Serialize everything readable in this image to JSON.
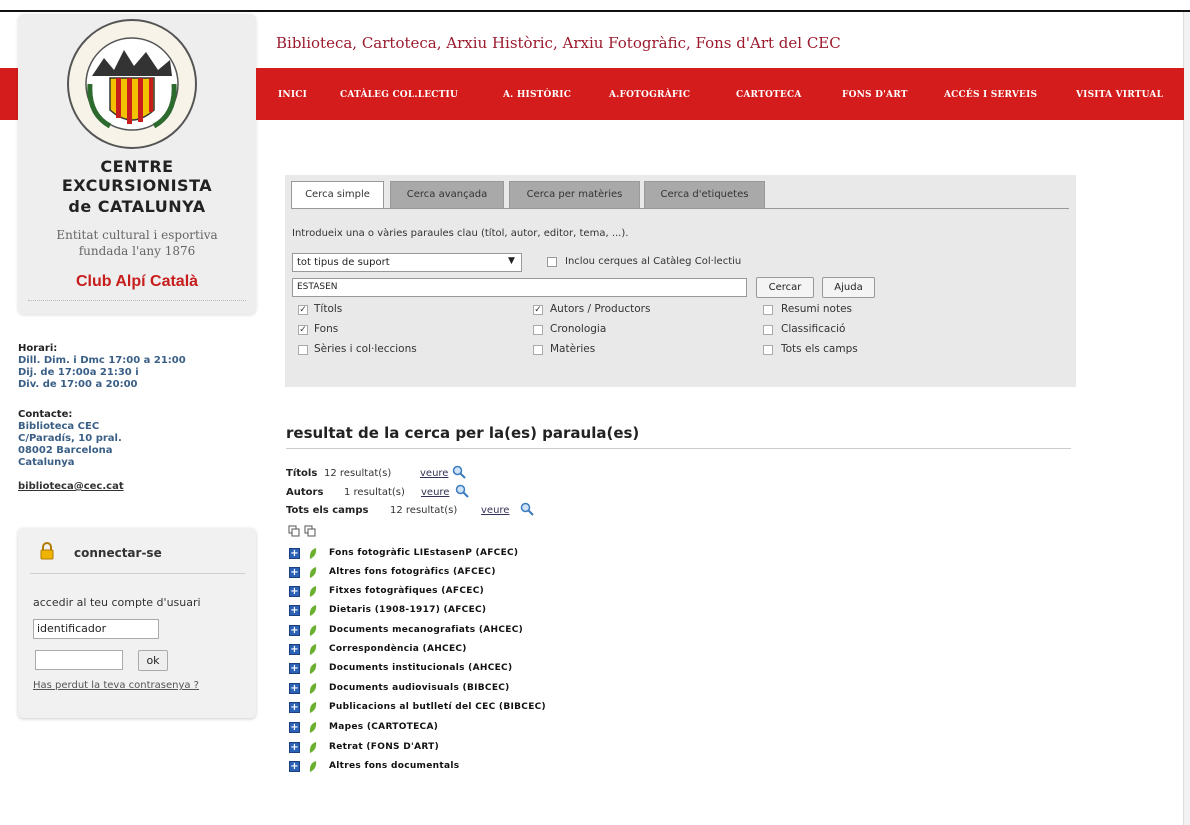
{
  "header": {
    "site_title": "Biblioteca, Cartoteca, Arxiu Històric, Arxiu Fotogràfic, Fons d'Art del CEC",
    "nav": [
      "INICI",
      "CATÀLEG COL.LECTIU",
      "A. HISTÒRIC",
      "A.FOTOGRÀFIC",
      "CARTOTECA",
      "FONS D'ART",
      "ACCÉS I SERVEIS",
      "VISITA VIRTUAL"
    ]
  },
  "sidebar": {
    "org_line1": "CENTRE",
    "org_line2": "EXCURSIONISTA",
    "org_line3": "de CATALUNYA",
    "tagline1": "Entitat cultural i esportiva",
    "tagline2": "fundada l'any 1876",
    "club": "Club Alpí Català",
    "horari_title": "Horari:",
    "horari": [
      "Dill. Dim. i Dmc 17:00 a 21:00",
      "Dij. de 17:00a 21:30 i",
      "Div. de 17:00 a 20:00"
    ],
    "contact_title": "Contacte:",
    "contact": [
      "Biblioteca CEC",
      "C/Paradís, 10 pral.",
      "08002 Barcelona",
      "Catalunya"
    ],
    "email": "biblioteca@cec.cat"
  },
  "login": {
    "title": "connectar-se",
    "account_label": "accedir al teu compte d'usuari",
    "user_value": "identificador",
    "ok_label": "ok",
    "forgot_link": "Has perdut la teva contrasenya ?"
  },
  "search": {
    "tabs": [
      "Cerca simple",
      "Cerca avançada",
      "Cerca per matèries",
      "Cerca d'etiquetes"
    ],
    "hint": "Introdueix una o vàries paraules clau (títol, autor, editor, tema, ...).",
    "support_value": "tot tipus de suport",
    "catalog_checkbox_label": "Inclou cerques al Catàleg Col·lectiu",
    "query_value": "ESTASEN",
    "search_button": "Cercar",
    "help_button": "Ajuda",
    "options": [
      {
        "label": "Títols",
        "checked": true
      },
      {
        "label": "Autors / Productors",
        "checked": true
      },
      {
        "label": "Resumi notes",
        "checked": false
      },
      {
        "label": "Fons",
        "checked": true
      },
      {
        "label": "Cronologia",
        "checked": false
      },
      {
        "label": "Classificació",
        "checked": false
      },
      {
        "label": "Sèries i col·leccions",
        "checked": false
      },
      {
        "label": "Matèries",
        "checked": false
      },
      {
        "label": "Tots els camps",
        "checked": false
      }
    ]
  },
  "results": {
    "heading": "resultat de la cerca per la(es) paraula(es)",
    "summary": [
      {
        "label": "Títols",
        "count": "12 resultat(s)",
        "link": "veure"
      },
      {
        "label": "Autors",
        "count": "1 resultat(s)",
        "link": "veure"
      },
      {
        "label": "Tots els camps",
        "count": "12 resultat(s)",
        "link": "veure"
      }
    ],
    "tree": [
      "Fons fotogràfic LIEstasenP (AFCEC)",
      "Altres fons fotogràfics (AFCEC)",
      "Fitxes fotogràfiques (AFCEC)",
      "Dietaris (1908-1917) (AFCEC)",
      "Documents mecanografiats (AHCEC)",
      "Correspondència (AHCEC)",
      "Documents institucionals (AHCEC)",
      "Documents audiovisuals (BIBCEC)",
      "Publicacions al butlletí del CEC (BIBCEC)",
      "Mapes (CARTOTECA)",
      "Retrat (FONS D'ART)",
      "Altres fons documentals"
    ]
  },
  "colors": {
    "nav_red": "#d51c1c",
    "title_red": "#9b1a2e",
    "club_red": "#c81d1d",
    "info_blue": "#3a5f86"
  }
}
